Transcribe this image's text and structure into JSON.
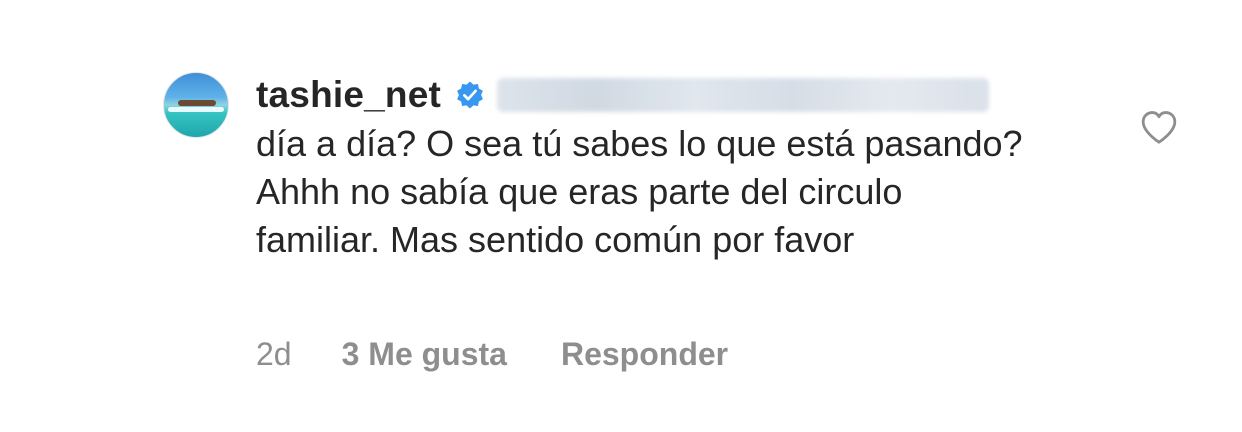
{
  "comment": {
    "username": "tashie_net",
    "verified": true,
    "text": "día a día? O sea tú sabes lo que está pasando? Ahhh no sabía que eras parte del circulo familiar. Mas sentido común por favor",
    "time": "2d",
    "likes": "3 Me gusta",
    "reply_label": "Responder"
  },
  "icons": {
    "verified": "verified-badge-icon",
    "like": "heart-outline-icon"
  },
  "colors": {
    "primary_text": "#262626",
    "secondary_text": "#8e8e8e",
    "verified_blue": "#3897f0",
    "background": "#ffffff"
  }
}
